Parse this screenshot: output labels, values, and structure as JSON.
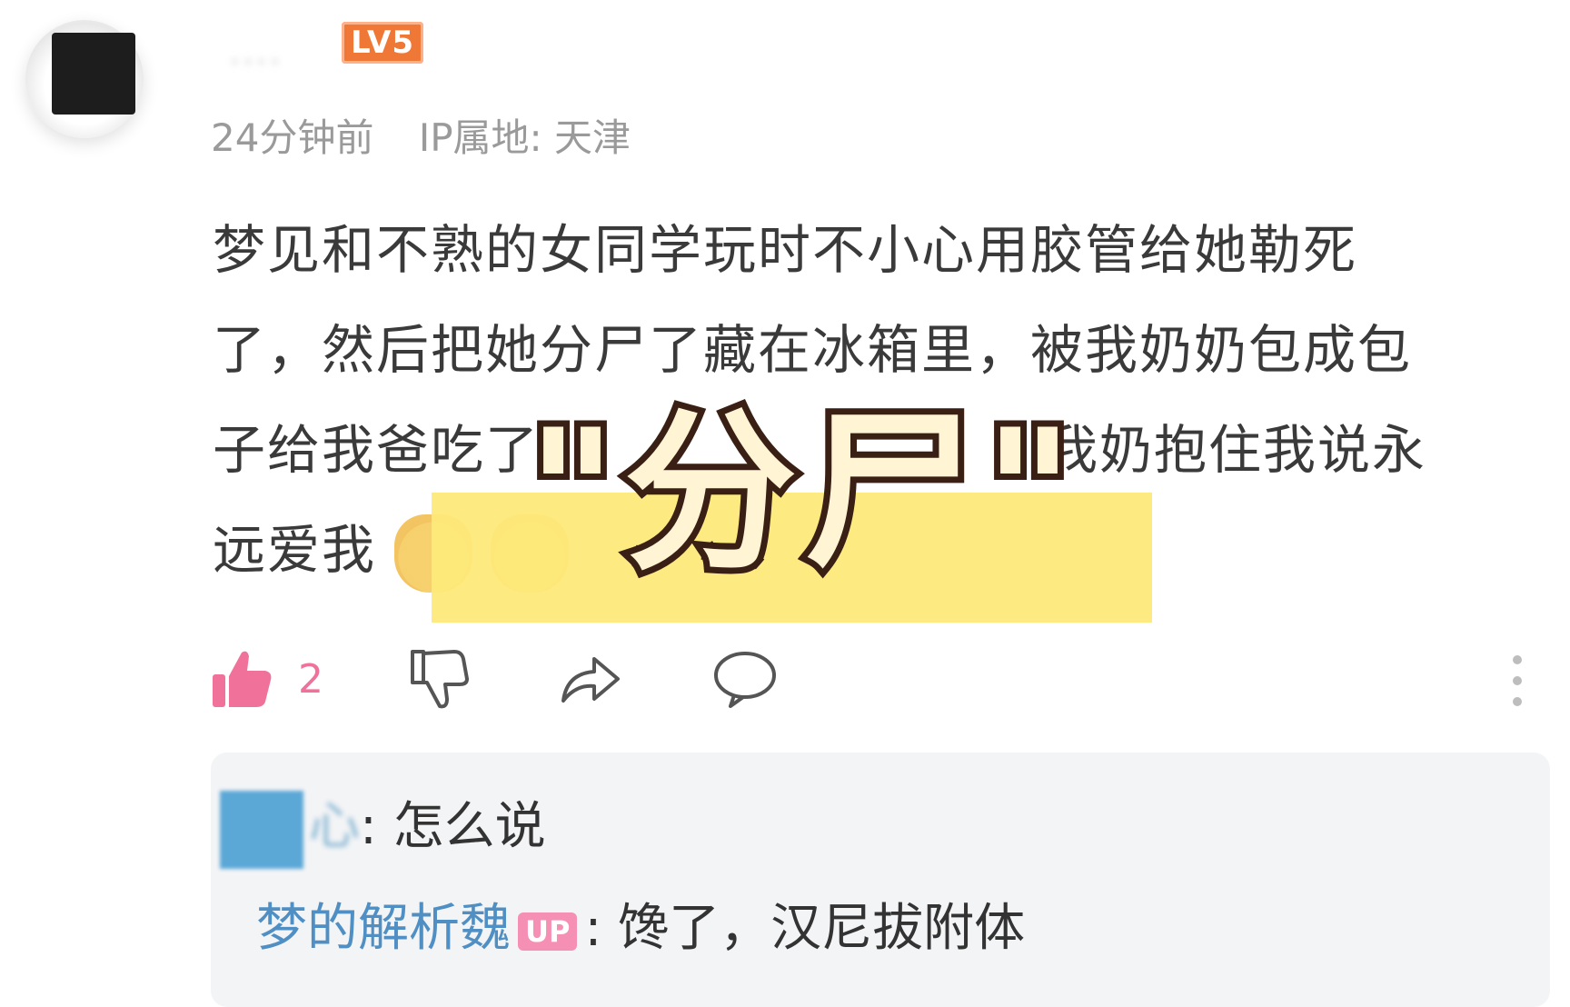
{
  "author": {
    "name_obscured": "····",
    "level_badge": "LV5",
    "time_ago": "24分钟前",
    "ip_location": "IP属地: 天津"
  },
  "comment": {
    "lines": [
      "梦见和不熟的女同学玩时不小心用胶管给她勒死",
      "了，然后把她分尸了藏在冰箱里，被我奶奶包成包",
      "子给我爸吃了，",
      "远爱我"
    ],
    "line3_tail": "，我奶抱住我说永",
    "emotes": [
      "cat-emote-icon",
      "cat-emote-icon"
    ]
  },
  "overlay": {
    "text": "\"分尸\"",
    "highlight_color": "#fde97a"
  },
  "actions": {
    "like_count": "2"
  },
  "replies": [
    {
      "user_obscured": "心",
      "text": ": 怎么说"
    },
    {
      "user": "梦的解析魏",
      "badge": "UP",
      "text": ": 馋了，汉尼拔附体"
    }
  ],
  "colors": {
    "level_badge": "#f07836",
    "like_active": "#f0729a",
    "reply_user": "#4f8fc4",
    "up_badge": "#f58fb4"
  }
}
